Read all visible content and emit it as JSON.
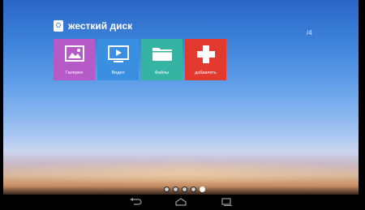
{
  "header": {
    "title": "жесткий диск",
    "page_indicator": "/4"
  },
  "tiles": [
    {
      "label": "Галерея",
      "icon": "gallery-icon",
      "color": "#b65ac8"
    },
    {
      "label": "Видео",
      "icon": "video-icon",
      "color": "#3a8fe0"
    },
    {
      "label": "Файлы",
      "icon": "folder-icon",
      "color": "#35b3a3"
    },
    {
      "label": "добавлять",
      "icon": "plus-icon",
      "color": "#e23a2e"
    }
  ],
  "page_dots": {
    "count": 5,
    "active_index": 4
  },
  "navbar": {
    "buttons": [
      "back-icon",
      "home-icon",
      "recents-icon"
    ]
  }
}
